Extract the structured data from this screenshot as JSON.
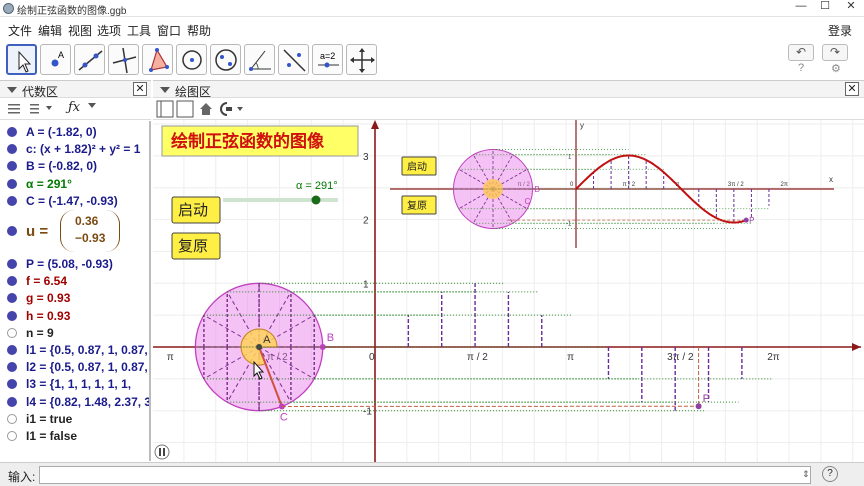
{
  "window": {
    "title": "绘制正弦函数的图像.ggb",
    "minimize": "—",
    "maximize": "☐",
    "close": "✕"
  },
  "menu": {
    "items": [
      "文件",
      "编辑",
      "视图",
      "选项",
      "工具",
      "窗口",
      "帮助"
    ],
    "login": "登录"
  },
  "toolbar": {
    "undo": "↶",
    "redo": "↷",
    "help": "?",
    "settings": "⚙"
  },
  "algebra": {
    "title": "代数区",
    "close": "✕",
    "fx": "ƒx",
    "items": [
      {
        "text": "A = (-1.82, 0)",
        "color": "#1a1a8c",
        "visible": true
      },
      {
        "text": "c: (x + 1.82)² + y² = 1",
        "color": "#1a1a8c",
        "visible": true
      },
      {
        "text": "B = (-0.82, 0)",
        "color": "#1a1a8c",
        "visible": true
      },
      {
        "text": "α = 291°",
        "color": "#007a00",
        "visible": true
      },
      {
        "text": "C = (-1.47, -0.93)",
        "color": "#1a1a8c",
        "visible": true
      },
      {
        "text": "u =",
        "color": "#7a4a10",
        "visible": true,
        "matrix": [
          "0.36",
          "−0.93"
        ]
      },
      {
        "text": "P = (5.08, -0.93)",
        "color": "#1a1a8c",
        "visible": true
      },
      {
        "text": "f = 6.54",
        "color": "#a00000",
        "visible": true
      },
      {
        "text": "g = 0.93",
        "color": "#a00000",
        "visible": true
      },
      {
        "text": "h = 0.93",
        "color": "#a00000",
        "visible": true
      },
      {
        "text": "n = 9",
        "color": "#222222",
        "visible": false
      },
      {
        "text": "l1 = {0.5, 0.87, 1, 0.87,",
        "color": "#1a1a8c",
        "visible": true
      },
      {
        "text": "l2 = {0.5, 0.87, 1, 0.87,",
        "color": "#1a1a8c",
        "visible": true
      },
      {
        "text": "l3 = {1, 1, 1, 1, 1, 1,",
        "color": "#1a1a8c",
        "visible": true
      },
      {
        "text": "l4 = {0.82, 1.48, 2.37, 3",
        "color": "#1a1a8c",
        "visible": true
      },
      {
        "text": "i1 = true",
        "color": "#222222",
        "visible": false
      },
      {
        "text": "I1 = false",
        "color": "#222222",
        "visible": false
      }
    ]
  },
  "graphics": {
    "title": "绘图区",
    "close": "✕",
    "heading": "绘制正弦函数的图像",
    "btn_start": "启动",
    "btn_reset": "复原",
    "slider_label": "α = 291°",
    "slider_value": 291,
    "slider_max": 360,
    "x_ticks": [
      "π",
      "π / 2",
      "0",
      "π / 2",
      "π",
      "3π / 2",
      "2π"
    ],
    "y_ticks": [
      "3",
      "2",
      "1",
      "-1"
    ],
    "points": [
      "A",
      "B",
      "C",
      "P"
    ],
    "inset": {
      "btn_start": "启动",
      "btn_reset": "复原",
      "y_label": "y",
      "x_label": "x",
      "x_ticks": [
        "π / 2",
        "0",
        "π / 2",
        "π",
        "3π / 2",
        "2π"
      ],
      "y_ticks": [
        "1",
        "-1"
      ],
      "points": [
        "B",
        "C",
        "P"
      ]
    }
  },
  "input": {
    "label": "输入:",
    "value": "",
    "help": "?"
  }
}
